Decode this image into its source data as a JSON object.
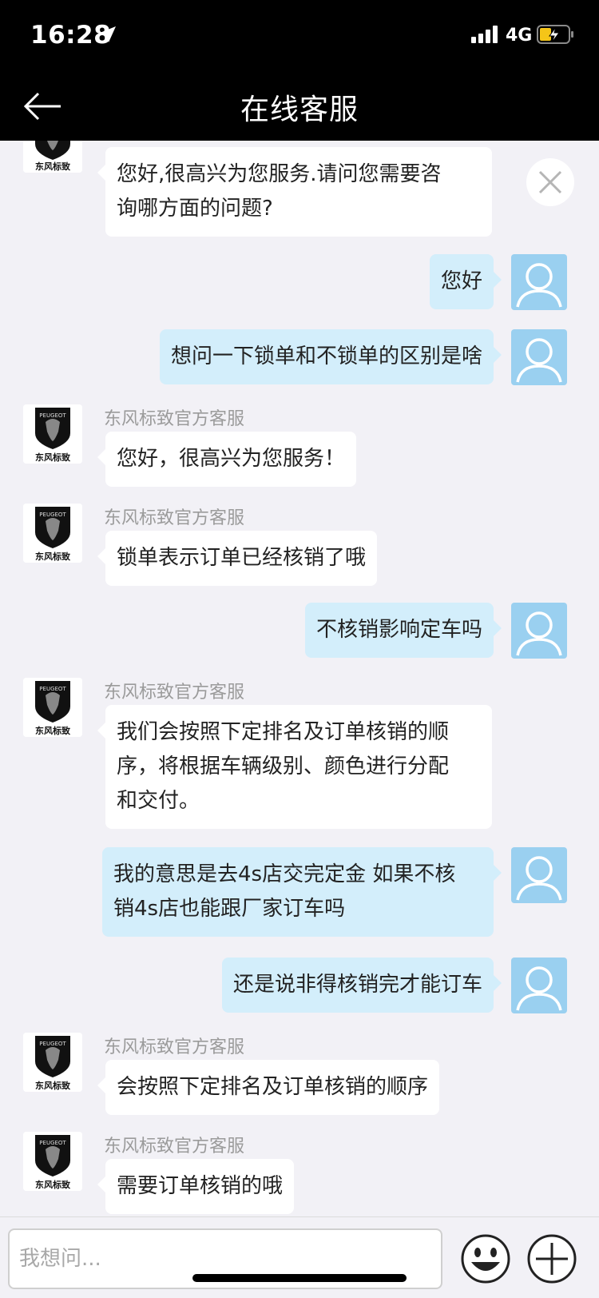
{
  "status_bar": {
    "time": "16:28",
    "network": "4G",
    "icons": [
      "location-arrow-icon",
      "signal-icon",
      "battery-charging-icon"
    ]
  },
  "nav": {
    "title": "在线客服",
    "back_icon": "arrow-left-icon"
  },
  "agent": {
    "name": "东风标致官方客服",
    "logo_text": "东风标致",
    "logo_brand": "PEUGEOT"
  },
  "messages": [
    {
      "from": "agent",
      "show_name": false,
      "lines": [
        "您好,很高兴为您服务.请问您需要咨",
        "询哪方面的问题?"
      ]
    },
    {
      "from": "user",
      "lines": [
        "您好"
      ]
    },
    {
      "from": "user",
      "lines": [
        "想问一下锁单和不锁单的区别是啥"
      ]
    },
    {
      "from": "agent",
      "show_name": true,
      "lines": [
        "您好，很高兴为您服务！"
      ]
    },
    {
      "from": "agent",
      "show_name": true,
      "lines": [
        "锁单表示订单已经核销了哦"
      ]
    },
    {
      "from": "user",
      "lines": [
        "不核销影响定车吗"
      ]
    },
    {
      "from": "agent",
      "show_name": true,
      "lines": [
        "我们会按照下定排名及订单核销的顺",
        "序，将根据车辆级别、颜色进行分配",
        "和交付。"
      ]
    },
    {
      "from": "user",
      "lines": [
        "我的意思是去4s店交完定金 如果不核",
        "销4s店也能跟厂家订车吗"
      ]
    },
    {
      "from": "user",
      "lines": [
        "还是说非得核销完才能订车"
      ]
    },
    {
      "from": "agent",
      "show_name": true,
      "lines": [
        "会按照下定排名及订单核销的顺序"
      ]
    },
    {
      "from": "agent",
      "show_name": true,
      "lines": [
        "需要订单核销的哦"
      ]
    }
  ],
  "input": {
    "placeholder": "我想问...",
    "emoji_icon": "smiley-face-icon",
    "plus_icon": "plus-circle-icon"
  },
  "colors": {
    "user_bubble": "#d3eefb",
    "agent_bubble": "#ffffff",
    "user_avatar": "#9ad0f0",
    "background": "#f2f1f6"
  }
}
